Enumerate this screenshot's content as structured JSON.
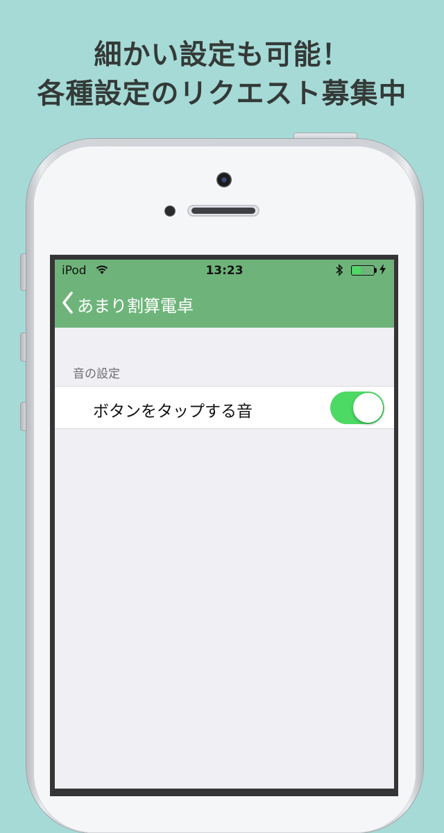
{
  "promo": {
    "line1": "細かい設定も可能！",
    "line2": "各種設定のリクエスト募集中"
  },
  "statusbar": {
    "carrier": "iPod",
    "time": "13:23",
    "battery_level": 0.4
  },
  "navbar": {
    "back_label": "あまり割算電卓"
  },
  "settings": {
    "section_header": "音の設定",
    "rows": [
      {
        "label": "ボタンをタップする音",
        "toggle_on": true
      }
    ]
  },
  "colors": {
    "background": "#a6dad6",
    "navbar": "#6eb47a",
    "switch_on": "#4cd964"
  }
}
